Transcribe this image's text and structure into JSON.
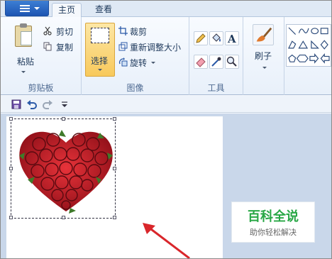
{
  "tabs": [
    {
      "label": "主页"
    },
    {
      "label": "查看"
    }
  ],
  "ribbon": {
    "clipboard": {
      "group_label": "剪贴板",
      "paste_label": "粘贴",
      "cut_label": "剪切",
      "copy_label": "复制"
    },
    "image": {
      "group_label": "图像",
      "select_label": "选择",
      "crop_label": "裁剪",
      "resize_label": "重新调整大小",
      "rotate_label": "旋转"
    },
    "tools": {
      "group_label": "工具",
      "icons": [
        "pencil-icon",
        "fill-icon",
        "text-icon",
        "eraser-icon",
        "color-picker-icon",
        "magnifier-icon"
      ]
    },
    "brushes": {
      "label": "刷子"
    },
    "shapes": {
      "icons": [
        "line-icon",
        "curve-icon",
        "oval-icon",
        "rectangle-icon",
        "rounded-rectangle-icon",
        "polygon-icon",
        "triangle-icon",
        "right-triangle-icon",
        "diamond-icon",
        "pentagon-icon",
        "hexagon-icon",
        "right-arrow-icon",
        "left-arrow-icon"
      ]
    }
  },
  "quick_access": {
    "icons": [
      "save-icon",
      "undo-icon",
      "redo-icon",
      "customize-icon"
    ]
  },
  "watermark": {
    "title": "百科全说",
    "subtitle": "助你轻松解决"
  },
  "colors": {
    "selected_button": "#f8c95c",
    "annotation_arrow": "#d9262b",
    "watermark_green": "#28a745"
  }
}
